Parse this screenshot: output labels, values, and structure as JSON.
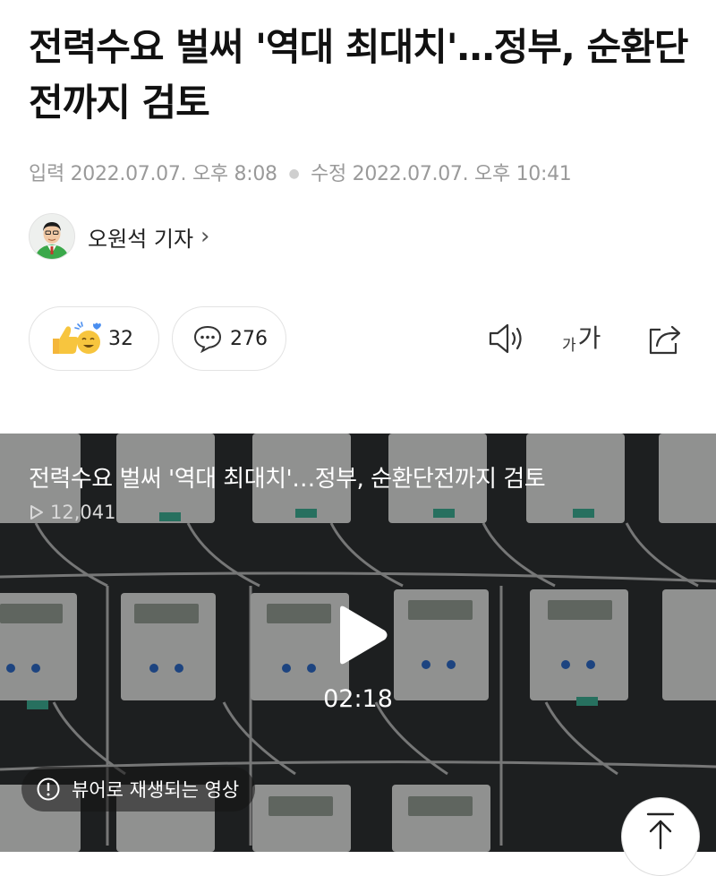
{
  "article": {
    "headline": "전력수요 벌써 '역대 최대치'…정부, 순환단전까지 검토",
    "input_label": "입력",
    "input_time": "2022.07.07. 오후 8:08",
    "edit_label": "수정",
    "edit_time": "2022.07.07. 오후 10:41"
  },
  "author": {
    "name": "오원석 기자",
    "chevron": "›"
  },
  "reactions": {
    "reaction_count": "32",
    "comment_count": "276"
  },
  "tools": {
    "font_small": "가",
    "font_large": "가",
    "icons": [
      "speaker-icon",
      "font-size-icon",
      "share-icon"
    ]
  },
  "video": {
    "title": "전력수요 벌써 '역대 최대치'…정부, 순환단전까지 검토",
    "views": "12,041",
    "duration": "02:18",
    "viewer_note": "뷰어로 재생되는 영상"
  },
  "colors": {
    "meta_gray": "#9a9a9a",
    "pill_border": "#e3e3e3",
    "emoji_yellow": "#f7c53e",
    "accent_blue": "#4a8ef0"
  }
}
